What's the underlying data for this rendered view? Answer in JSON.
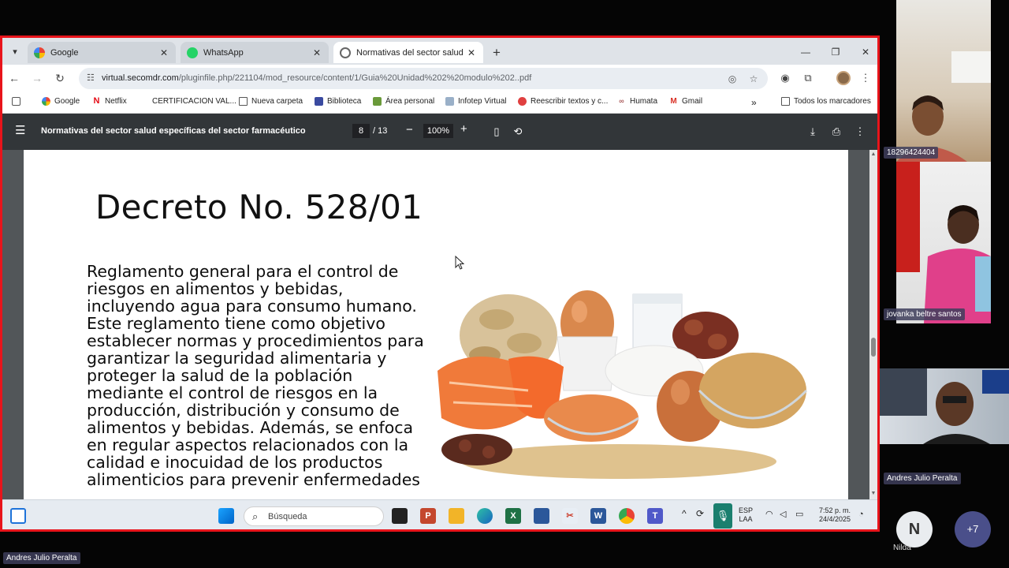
{
  "browser": {
    "tabs": [
      {
        "title": "Google",
        "active": false
      },
      {
        "title": "WhatsApp",
        "active": false
      },
      {
        "title": "Normativas del sector salud esp",
        "active": true
      }
    ],
    "new_tab": "+",
    "url_host": "virtual.secomdr.com",
    "url_path": "/pluginfile.php/221104/mod_resource/content/1/Guia%20Unidad%202%20modulo%202..pdf",
    "bookmarks": [
      {
        "label": "Google"
      },
      {
        "label": "Netflix"
      },
      {
        "label": "CERTIFICACION VAL..."
      },
      {
        "label": "Nueva carpeta"
      },
      {
        "label": "Biblioteca"
      },
      {
        "label": "Área personal"
      },
      {
        "label": "Infotep Virtual"
      },
      {
        "label": "Reescribir textos y c..."
      },
      {
        "label": "Humata"
      },
      {
        "label": "Gmail"
      }
    ],
    "all_bookmarks": "Todos los marcadores",
    "more_bookmarks": "»"
  },
  "pdf": {
    "title": "Normativas del sector salud específicas del sector farmacéutico",
    "page_current": "8",
    "page_total": "/ 13",
    "zoom": "100%",
    "heading": "Decreto No. 528/01",
    "body": "Reglamento general para el control de riesgos en alimentos y bebidas, incluyendo agua para consumo humano. Este reglamento tiene como objetivo establecer normas y procedimientos para garantizar la seguridad alimentaria y proteger la salud de la población mediante el control de riesgos en la producción, distribución y consumo de alimentos y bebidas. Además, se enfoca en regular aspectos relacionados con la calidad e inocuidad de los productos alimenticios para prevenir enfermedades"
  },
  "taskbar": {
    "search_placeholder": "Búsqueda",
    "lang_top": "ESP",
    "lang_bottom": "LAA",
    "time": "7:52 p. m.",
    "date": "24/4/2025"
  },
  "participants": {
    "p1": "18296424404",
    "p2": "jovanka beltre santos",
    "p3": "Andres Julio Peralta",
    "nilda_initial": "N",
    "nilda_name": "Nilda",
    "more": "+7",
    "presenter": "Andres Julio Peralta"
  },
  "colors": {
    "share_border": "#e8141b",
    "pdf_toolbar": "#323639",
    "name_tag": "#3e3e5c"
  }
}
